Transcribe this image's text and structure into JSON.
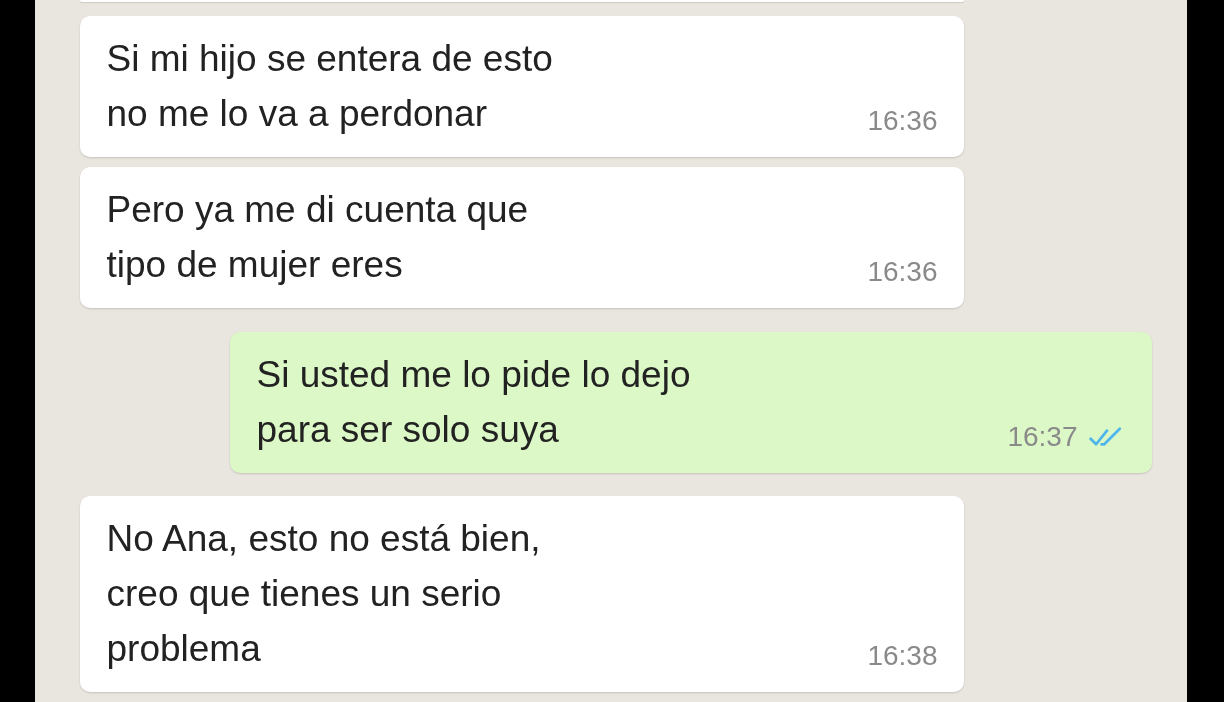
{
  "messages": [
    {
      "kind": "partial"
    },
    {
      "kind": "incoming",
      "text": "Si mi hijo se entera de esto\nno me lo va a perdonar",
      "time": "16:36"
    },
    {
      "kind": "incoming",
      "text": "Pero ya me di cuenta que\ntipo de mujer eres",
      "time": "16:36"
    },
    {
      "kind": "outgoing",
      "text": "Si usted me lo pide lo dejo\npara ser solo suya",
      "time": "16:37",
      "read": true
    },
    {
      "kind": "incoming",
      "text": "No Ana, esto no está bien,\ncreo que tienes un serio\nproblema",
      "time": "16:38"
    }
  ]
}
